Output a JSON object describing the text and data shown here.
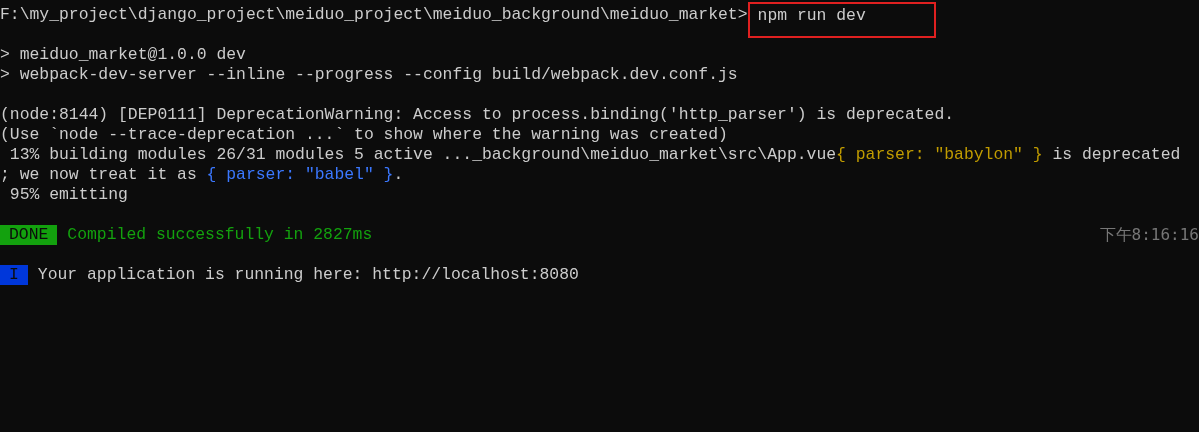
{
  "terminal": {
    "blocks": [
      [
        {
          "segments": [
            {
              "kind": "plain",
              "text": "F:\\my_project\\django_project\\meiduo_project\\meiduo_background\\meiduo_market>"
            },
            {
              "kind": "boxed",
              "text": "npm run dev"
            }
          ]
        }
      ],
      [
        {
          "segments": [
            {
              "kind": "plain",
              "text": "> meiduo_market@1.0.0 dev"
            }
          ]
        },
        {
          "segments": [
            {
              "kind": "plain",
              "text": "> webpack-dev-server --inline --progress --config build/webpack.dev.conf.js"
            }
          ]
        }
      ],
      [
        {
          "segments": [
            {
              "kind": "plain",
              "text": "(node:8144) [DEP0111] DeprecationWarning: Access to process.binding('http_parser') is deprecated."
            }
          ]
        },
        {
          "segments": [
            {
              "kind": "plain",
              "text": "(Use `node --trace-deprecation ...` to show where the warning was created)"
            }
          ]
        },
        {
          "segments": [
            {
              "kind": "plain",
              "text": " 13% building modules 26/31 modules 5 active ..._background\\meiduo_market\\src\\App.vue"
            },
            {
              "kind": "yellow",
              "text": "{ parser: \"babylon\" }"
            },
            {
              "kind": "plain",
              "text": " is deprecated"
            }
          ]
        },
        {
          "segments": [
            {
              "kind": "plain",
              "text": "; we now treat it as "
            },
            {
              "kind": "blue",
              "text": "{ parser: \"babel\" }"
            },
            {
              "kind": "plain",
              "text": "."
            }
          ]
        },
        {
          "segments": [
            {
              "kind": "plain",
              "text": " 95% emitting"
            }
          ]
        }
      ],
      [
        {
          "segments": [
            {
              "kind": "done_badge",
              "text": "DONE"
            },
            {
              "kind": "green",
              "text": "Compiled successfully in 2827ms"
            },
            {
              "kind": "time",
              "text": "下午8:16:16"
            }
          ]
        }
      ],
      [
        {
          "segments": [
            {
              "kind": "info_badge",
              "text": "I"
            },
            {
              "kind": "plain",
              "text": "Your application is running here: http://localhost:8080"
            }
          ]
        }
      ]
    ]
  }
}
